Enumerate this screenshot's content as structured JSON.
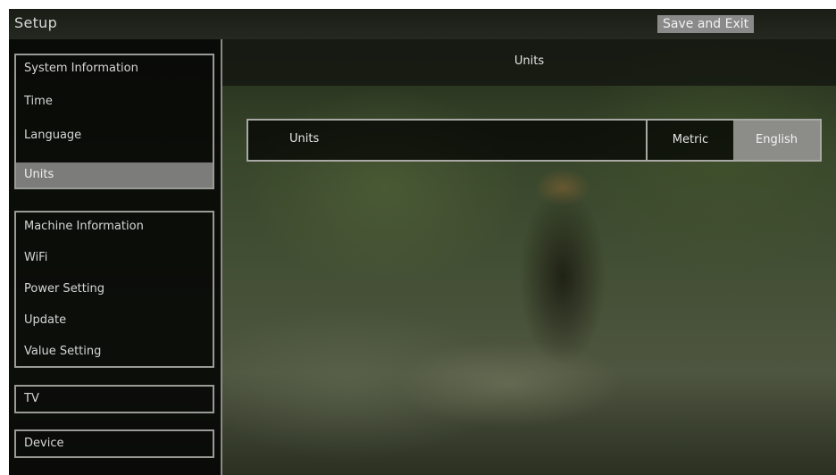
{
  "header": {
    "title": "Setup",
    "save_exit_label": "Save and Exit"
  },
  "sidebar": {
    "groups": [
      {
        "items": [
          {
            "label": "System Information"
          },
          {
            "label": "Time"
          },
          {
            "label": "Language"
          },
          {
            "label": "Units",
            "selected": true
          }
        ]
      },
      {
        "items": [
          {
            "label": "Machine Information"
          },
          {
            "label": "WiFi"
          },
          {
            "label": "Power Setting"
          },
          {
            "label": "Update"
          },
          {
            "label": "Value Setting"
          }
        ]
      },
      {
        "items": [
          {
            "label": "TV"
          }
        ]
      },
      {
        "items": [
          {
            "label": "Device"
          }
        ]
      }
    ]
  },
  "main": {
    "section_title": "Units",
    "setting": {
      "label": "Units",
      "options": [
        "Metric",
        "English"
      ],
      "selected": "English"
    }
  },
  "colors": {
    "selected_bg": "#7c7c7a",
    "option_selected_bg": "#8c8c89",
    "save_button_bg": "#8a8a8a",
    "border": "#9a9a96"
  }
}
